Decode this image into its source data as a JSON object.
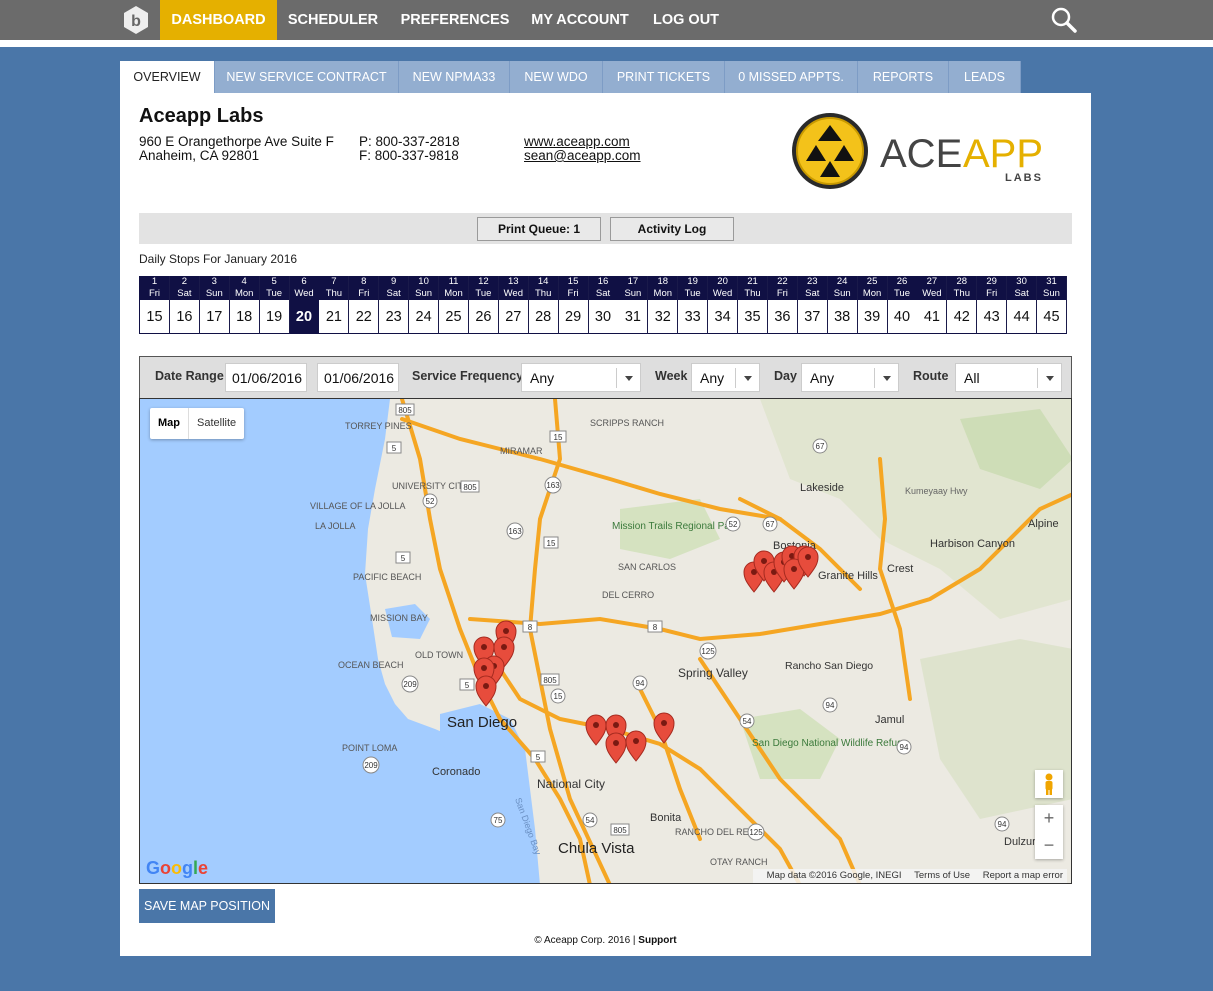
{
  "nav": {
    "items": [
      "DASHBOARD",
      "SCHEDULER",
      "PREFERENCES",
      "MY ACCOUNT",
      "LOG OUT"
    ],
    "active": "DASHBOARD",
    "accent": "#e5b000"
  },
  "tabs": [
    "OVERVIEW",
    "NEW SERVICE CONTRACT",
    "NEW NPMA33",
    "NEW WDO",
    "PRINT TICKETS",
    "0 MISSED APPTS.",
    "REPORTS",
    "LEADS"
  ],
  "company": {
    "name": "Aceapp Labs",
    "address1": "960 E Orangethorpe Ave Suite F",
    "address2": "Anaheim, CA 92801",
    "phone": "P: 800-337-2818",
    "fax": "F: 800-337-9818",
    "website": "www.aceapp.com",
    "email": "sean@aceapp.com",
    "logo_text_a": "ACE",
    "logo_text_b": "APP",
    "logo_sub": "LABS"
  },
  "toolbar": {
    "print_queue": "Print Queue: 1",
    "activity_log": "Activity Log"
  },
  "daily": {
    "title": "Daily Stops For January 2016",
    "days": [
      {
        "d": "1",
        "w": "Fri",
        "n": "15"
      },
      {
        "d": "2",
        "w": "Sat",
        "n": "16"
      },
      {
        "d": "3",
        "w": "Sun",
        "n": "17"
      },
      {
        "d": "4",
        "w": "Mon",
        "n": "18"
      },
      {
        "d": "5",
        "w": "Tue",
        "n": "19"
      },
      {
        "d": "6",
        "w": "Wed",
        "n": "20"
      },
      {
        "d": "7",
        "w": "Thu",
        "n": "21"
      },
      {
        "d": "8",
        "w": "Fri",
        "n": "22"
      },
      {
        "d": "9",
        "w": "Sat",
        "n": "23"
      },
      {
        "d": "10",
        "w": "Sun",
        "n": "24"
      },
      {
        "d": "11",
        "w": "Mon",
        "n": "25"
      },
      {
        "d": "12",
        "w": "Tue",
        "n": "26"
      },
      {
        "d": "13",
        "w": "Wed",
        "n": "27"
      },
      {
        "d": "14",
        "w": "Thu",
        "n": "28"
      },
      {
        "d": "15",
        "w": "Fri",
        "n": "29"
      },
      {
        "d": "16",
        "w": "Sat",
        "n": "30"
      },
      {
        "d": "17",
        "w": "Sun",
        "n": "31"
      },
      {
        "d": "18",
        "w": "Mon",
        "n": "32"
      },
      {
        "d": "19",
        "w": "Tue",
        "n": "33"
      },
      {
        "d": "20",
        "w": "Wed",
        "n": "34"
      },
      {
        "d": "21",
        "w": "Thu",
        "n": "35"
      },
      {
        "d": "22",
        "w": "Fri",
        "n": "36"
      },
      {
        "d": "23",
        "w": "Sat",
        "n": "37"
      },
      {
        "d": "24",
        "w": "Sun",
        "n": "38"
      },
      {
        "d": "25",
        "w": "Mon",
        "n": "39"
      },
      {
        "d": "26",
        "w": "Tue",
        "n": "40"
      },
      {
        "d": "27",
        "w": "Wed",
        "n": "41"
      },
      {
        "d": "28",
        "w": "Thu",
        "n": "42"
      },
      {
        "d": "29",
        "w": "Fri",
        "n": "43"
      },
      {
        "d": "30",
        "w": "Sat",
        "n": "44"
      },
      {
        "d": "31",
        "w": "Sun",
        "n": "45"
      }
    ],
    "selected_day": "6"
  },
  "filters": {
    "date_range_label": "Date Range",
    "date_from": "01/06/2016",
    "date_to": "01/06/2016",
    "frequency_label": "Service Frequency",
    "frequency_value": "Any",
    "week_label": "Week",
    "week_value": "Any",
    "day_label": "Day",
    "day_value": "Any",
    "route_label": "Route",
    "route_value": "All"
  },
  "map": {
    "type_map": "Map",
    "type_satellite": "Satellite",
    "attribution": "Map data ©2016 Google, INEGI",
    "terms": "Terms of Use",
    "report": "Report a map error",
    "google": "Google",
    "labels": [
      "TORREY PINES",
      "SCRIPPS RANCH",
      "MIRAMAR",
      "UNIVERSITY CITY",
      "Lakeside",
      "Kumeyaay Hwy",
      "Alpine",
      "VILLAGE OF LA JOLLA",
      "LA JOLLA",
      "Mission Trails Regional Park",
      "Bostonia",
      "Harbison Canyon",
      "Granite Hills",
      "Crest",
      "PACIFIC BEACH",
      "SAN CARLOS",
      "DEL CERRO",
      "MISSION BAY",
      "OCEAN BEACH",
      "OLD TOWN",
      "Spring Valley",
      "Rancho San Diego",
      "San Diego",
      "Jamul",
      "POINT LOMA",
      "Coronado",
      "San Diego National Wildlife Refuge",
      "National City",
      "Bonita",
      "RANCHO DEL REY",
      "San Diego Bay",
      "Chula Vista",
      "OTAY RANCH",
      "Dulzura"
    ],
    "road_shields": [
      "805",
      "15",
      "67",
      "5",
      "52",
      "163",
      "805",
      "52",
      "67",
      "163",
      "15",
      "5",
      "8",
      "8",
      "125",
      "209",
      "5",
      "805",
      "94",
      "15",
      "94",
      "54",
      "94",
      "5",
      "209",
      "54",
      "805",
      "125",
      "75",
      "94"
    ]
  },
  "save_button": "SAVE MAP POSITION",
  "footer": {
    "text": "© Aceapp Corp. 2016 | ",
    "support": "Support"
  }
}
